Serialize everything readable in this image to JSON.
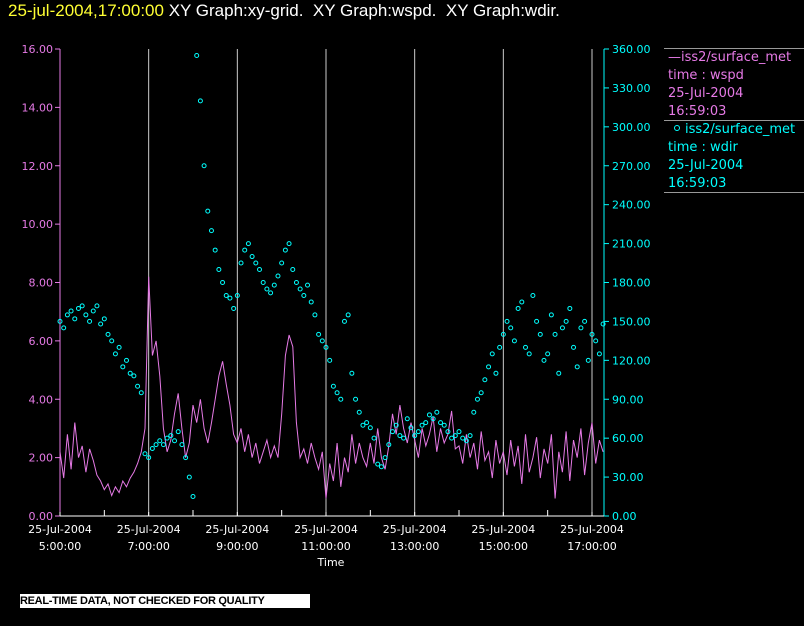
{
  "header": {
    "datetime": "25-jul-2004,17:00:00",
    "title": " XY Graph:xy-grid.  XY Graph:wspd.  XY Graph:wdir."
  },
  "colors": {
    "wspd": "#e67ae6",
    "wdir": "#00ffff",
    "title_date": "#ffff33"
  },
  "legend": [
    {
      "marker": "line",
      "name": "—iss2/surface_met",
      "var": "time : wspd",
      "date": "25-Jul-2004",
      "time": "16:59:03"
    },
    {
      "marker": "circle",
      "name": "iss2/surface_met",
      "var": "time : wdir",
      "date": "25-Jul-2004",
      "time": "16:59:03"
    }
  ],
  "footer": {
    "quality_note": "REAL-TIME DATA, NOT CHECKED FOR QUALITY"
  },
  "chart_data": {
    "type": "line",
    "xlabel": "Time",
    "x_start": "25-Jul-2004 5:00:00",
    "x_interval_minutes": 5,
    "xlim_hours": [
      5,
      17.27
    ],
    "x_ticks": [
      {
        "hour": 5,
        "date": "25-Jul-2004",
        "time": "5:00:00"
      },
      {
        "hour": 7,
        "date": "25-Jul-2004",
        "time": "7:00:00"
      },
      {
        "hour": 9,
        "date": "25-Jul-2004",
        "time": "9:00:00"
      },
      {
        "hour": 11,
        "date": "25-Jul-2004",
        "time": "11:00:00"
      },
      {
        "hour": 13,
        "date": "25-Jul-2004",
        "time": "13:00:00"
      },
      {
        "hour": 15,
        "date": "25-Jul-2004",
        "time": "15:00:00"
      },
      {
        "hour": 17,
        "date": "25-Jul-2004",
        "time": "17:00:00"
      }
    ],
    "grid": "vertical",
    "left_axis": {
      "ylim": [
        0,
        16
      ],
      "ticks": [
        "0.00",
        "2.00",
        "4.00",
        "6.00",
        "8.00",
        "10.00",
        "12.00",
        "14.00",
        "16.00"
      ]
    },
    "right_axis": {
      "ylim": [
        0,
        360
      ],
      "ticks": [
        "0.00",
        "30.00",
        "60.00",
        "90.00",
        "120.00",
        "150.00",
        "180.00",
        "210.00",
        "240.00",
        "270.00",
        "300.00",
        "330.00",
        "360.00"
      ]
    },
    "series": [
      {
        "name": "wspd",
        "type": "line",
        "axis": "left",
        "values": [
          2.2,
          1.3,
          2.8,
          1.6,
          3.2,
          2.0,
          2.4,
          1.5,
          2.3,
          1.9,
          1.4,
          1.2,
          0.9,
          1.1,
          0.7,
          1.0,
          0.8,
          1.2,
          1.0,
          1.3,
          1.5,
          1.8,
          2.2,
          3.0,
          8.2,
          5.5,
          6.0,
          4.8,
          3.0,
          2.2,
          2.6,
          3.5,
          4.2,
          3.0,
          2.0,
          2.5,
          3.8,
          3.2,
          4.0,
          3.0,
          2.5,
          3.2,
          4.0,
          4.8,
          5.3,
          4.5,
          3.8,
          2.8,
          2.5,
          3.0,
          2.2,
          2.8,
          2.0,
          2.5,
          1.8,
          2.2,
          2.6,
          2.0,
          2.4,
          2.0,
          3.5,
          5.5,
          6.2,
          5.8,
          3.2,
          2.0,
          2.3,
          1.8,
          2.5,
          2.0,
          1.6,
          2.2,
          0.6,
          1.8,
          1.2,
          2.5,
          1.0,
          2.0,
          1.5,
          2.8,
          1.8,
          2.5,
          2.0,
          1.7,
          2.5,
          1.8,
          3.0,
          2.0,
          1.6,
          2.4,
          3.5,
          2.8,
          3.8,
          3.0,
          2.5,
          3.2,
          2.6,
          2.0,
          3.0,
          2.4,
          2.8,
          3.4,
          2.2,
          3.0,
          2.5,
          2.8,
          3.6,
          2.3,
          2.4,
          1.8,
          2.8,
          2.0,
          2.5,
          1.6,
          2.9,
          1.9,
          2.2,
          1.3,
          2.6,
          1.8,
          2.2,
          1.4,
          2.6,
          1.7,
          2.4,
          1.1,
          2.8,
          1.5,
          2.0,
          2.7,
          1.3,
          2.3,
          1.8,
          2.8,
          0.6,
          2.2,
          1.5,
          2.9,
          1.2,
          2.6,
          2.0,
          3.0,
          1.4,
          2.5,
          3.2,
          1.8,
          2.6,
          2.2
        ]
      },
      {
        "name": "wdir",
        "type": "scatter",
        "axis": "right",
        "values": [
          150,
          145,
          155,
          158,
          152,
          160,
          162,
          155,
          150,
          158,
          162,
          148,
          152,
          140,
          135,
          125,
          130,
          115,
          120,
          110,
          108,
          100,
          95,
          48,
          45,
          52,
          55,
          58,
          55,
          60,
          62,
          58,
          65,
          55,
          45,
          30,
          15,
          355,
          320,
          270,
          235,
          220,
          205,
          190,
          180,
          170,
          168,
          160,
          170,
          195,
          205,
          210,
          200,
          195,
          190,
          180,
          175,
          172,
          178,
          185,
          195,
          205,
          210,
          190,
          180,
          175,
          170,
          178,
          165,
          155,
          140,
          135,
          130,
          120,
          100,
          95,
          90,
          150,
          155,
          110,
          90,
          80,
          70,
          72,
          68,
          60,
          40,
          38,
          45,
          55,
          65,
          70,
          62,
          60,
          75,
          68,
          62,
          65,
          70,
          72,
          78,
          75,
          80,
          72,
          70,
          65,
          60,
          62,
          65,
          60,
          58,
          62,
          80,
          90,
          95,
          105,
          115,
          125,
          110,
          130,
          140,
          150,
          145,
          135,
          160,
          165,
          130,
          125,
          170,
          150,
          140,
          120,
          125,
          155,
          140,
          110,
          145,
          150,
          160,
          130,
          115,
          145,
          150,
          120,
          140,
          135,
          125,
          148
        ]
      }
    ]
  }
}
